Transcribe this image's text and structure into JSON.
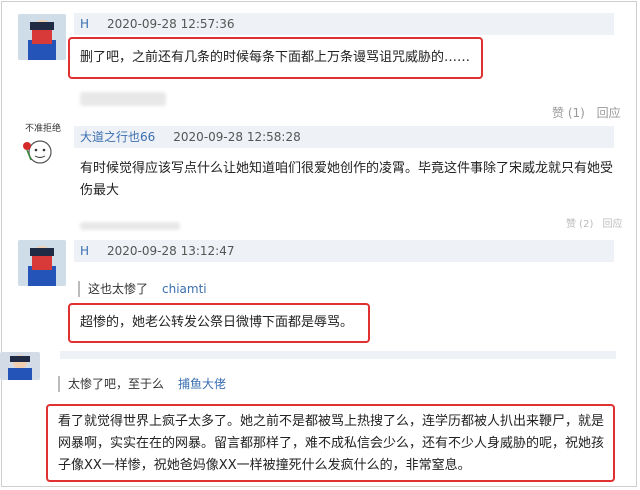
{
  "comments": [
    {
      "user": "H",
      "time": "2020-09-28 12:57:36",
      "text": "删了吧，之前还有几条的时候每条下面都上万条谩骂诅咒威胁的……",
      "likes": "赞 (1)",
      "reply": "回应"
    },
    {
      "user": "大道之行也66",
      "time": "2020-09-28 12:58:28",
      "avatar_caption": "不准拒绝",
      "text": "有时候觉得应该写点什么让她知道咱们很爱她创作的凌霄。毕竟这件事除了宋威龙就只有她受伤最大",
      "likes": "赞 (2)",
      "reply": "回应"
    },
    {
      "user": "H",
      "time": "2020-09-28 13:12:47",
      "quote_text": "这也太惨了",
      "quote_user": "chiamti",
      "text": "超惨的，她老公转发公祭日微博下面都是辱骂。"
    },
    {
      "quote_text": "太惨了吧，至于么",
      "quote_user": "捕鱼大佬",
      "text": "看了就觉得世界上疯子太多了。她之前不是都被骂上热搜了么，连学历都被人扒出来鞭尸，就是网暴啊，实实在在的网暴。留言都那样了，难不成私信会少么，还有不少人身威胁的呢，祝她孩子像XX一样惨，祝她爸妈像XX一样被撞死什么发疯什么的，非常窒息。"
    }
  ]
}
